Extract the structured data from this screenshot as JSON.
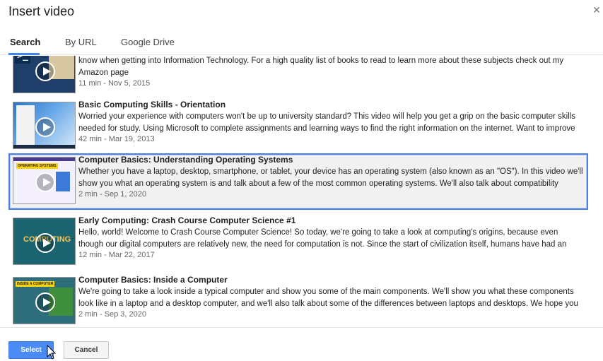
{
  "dialog": {
    "title": "Insert video",
    "close_icon": "close-icon"
  },
  "tabs": [
    {
      "label": "Search",
      "active": true
    },
    {
      "label": "By URL",
      "active": false
    },
    {
      "label": "Google Drive",
      "active": false
    }
  ],
  "results": [
    {
      "title": "",
      "description": "know when getting into Information Technology. For a high quality list of books to read to learn more about these subjects check out my Amazon page",
      "meta": "11 min - Nov 5, 2015",
      "selected": false
    },
    {
      "title": "Basic Computing Skills - Orientation",
      "description": "Worried your experience with computers won't be up to university standard? This video will help you get a grip on the basic computer skills needed for study. Using Microsoft to complete assignments and learning ways to find the right information on the internet. Want to improve your skills even",
      "meta": "42 min - Mar 19, 2013",
      "selected": false
    },
    {
      "title": "Computer Basics: Understanding Operating Systems",
      "description": "Whether you have a laptop, desktop, smartphone, or tablet, your device has an operating system (also known as an \"OS\"). In this video we'll show you what an operating system is and talk about a few of the most common operating systems. We'll also talk about compatibility issues. Some software is",
      "meta": "2 min - Sep 1, 2020",
      "selected": true,
      "thumb_text": "OPERATING SYSTEMS"
    },
    {
      "title": "Early Computing: Crash Course Computer Science #1",
      "description": "Hello, world! Welcome to Crash Course Computer Science! So today, we're going to take a look at computing's origins, because even though our digital computers are relatively new, the need for computation is not. Since the start of civilization itself, humans have had an increasing need for special",
      "meta": "12 min - Mar 22, 2017",
      "selected": false,
      "thumb_text": "COMPUTING"
    },
    {
      "title": "Computer Basics: Inside a Computer",
      "description": "We're going to take a look inside a typical computer and show you some of the main components. We'll show you what these components look like in a laptop and a desktop computer, and we'll also talk about some of the differences between laptops and desktops. We hope you enjoy! To learn more,",
      "meta": "2 min - Sep 3, 2020",
      "selected": false,
      "thumb_text": "INSIDE A COMPUTER"
    }
  ],
  "footer": {
    "select_label": "Select",
    "cancel_label": "Cancel"
  },
  "colors": {
    "accent": "#4a8af4",
    "selected_border": "#4d80e4"
  }
}
